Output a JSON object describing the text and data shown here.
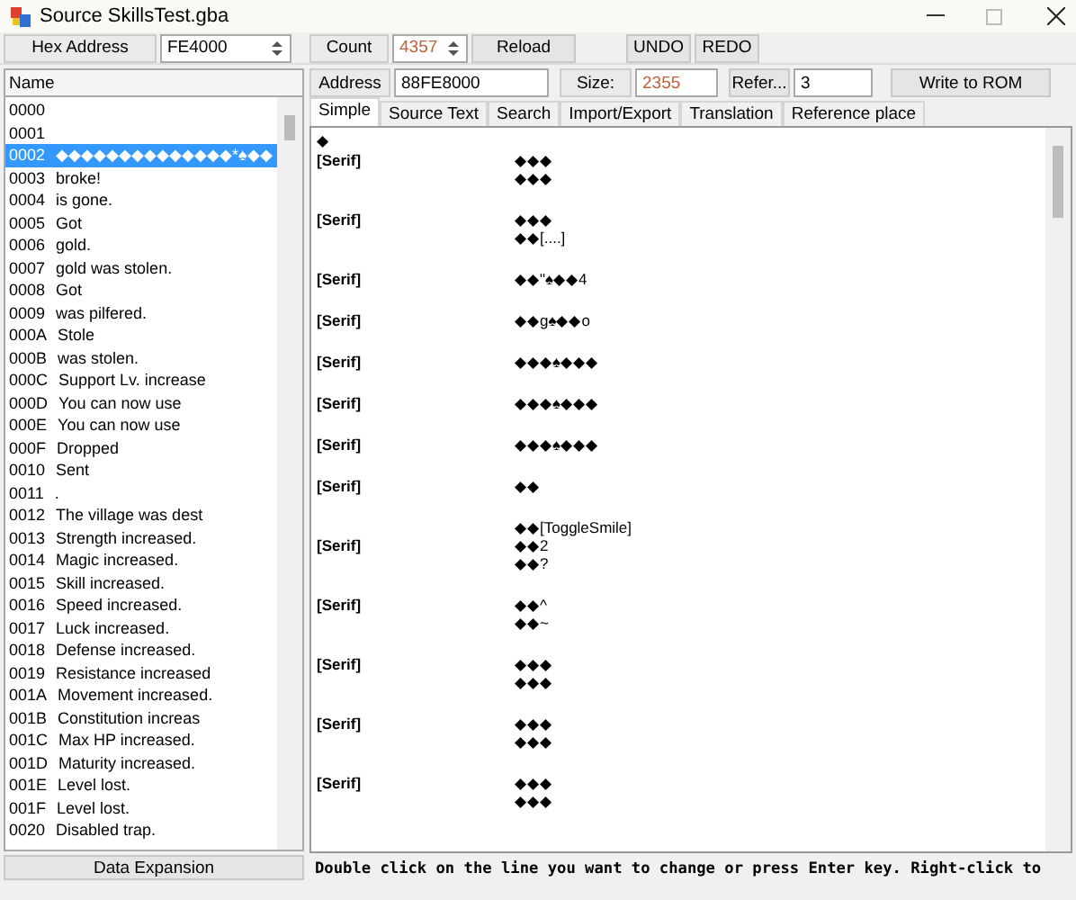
{
  "window": {
    "title": "Source SkillsTest.gba"
  },
  "toolbar": {
    "hex_address_label": "Hex Address",
    "hex_address": "FE4000",
    "count_label": "Count",
    "count": "4357",
    "buttons": [
      "Reload",
      "UNDO",
      "REDO"
    ]
  },
  "list": {
    "header": "Name",
    "items": [
      {
        "id": "0000",
        "selected": false
      },
      {
        "id": "0001",
        "selected": false
      },
      {
        "id": "0002",
        "text": "◆◆◆◆◆◆◆◆◆◆◆◆◆◆*♠◆◆",
        "selected": true
      },
      {
        "id": "0003",
        "text": "broke!",
        "selected": false
      },
      {
        "id": "0004",
        "text": "is gone.",
        "selected": false
      },
      {
        "id": "0005",
        "text": "Got",
        "selected": false
      },
      {
        "id": "0006",
        "text": "gold.",
        "selected": false
      },
      {
        "id": "0007",
        "text": "gold was stolen.",
        "selected": false
      },
      {
        "id": "0008",
        "text": "Got",
        "selected": false
      },
      {
        "id": "0009",
        "text": "was pilfered.",
        "selected": false
      },
      {
        "id": "000A",
        "text": "Stole",
        "selected": false
      },
      {
        "id": "000B",
        "text": "was stolen.",
        "selected": false
      },
      {
        "id": "000C",
        "text": "Support Lv. increase",
        "selected": false
      },
      {
        "id": "000D",
        "text": "You can now use",
        "selected": false
      },
      {
        "id": "000E",
        "text": "You can now use",
        "selected": false
      },
      {
        "id": "000F",
        "text": "Dropped",
        "selected": false
      },
      {
        "id": "0010",
        "text": "Sent",
        "selected": false
      },
      {
        "id": "0011",
        "text": ".",
        "selected": false
      },
      {
        "id": "0012",
        "text": "The village was dest",
        "selected": false
      },
      {
        "id": "0013",
        "text": "Strength increased.",
        "selected": false
      },
      {
        "id": "0014",
        "text": "Magic increased.",
        "selected": false
      },
      {
        "id": "0015",
        "text": "Skill increased.",
        "selected": false
      },
      {
        "id": "0016",
        "text": "Speed increased.",
        "selected": false
      },
      {
        "id": "0017",
        "text": "Luck increased.",
        "selected": false
      },
      {
        "id": "0018",
        "text": "Defense increased.",
        "selected": false
      },
      {
        "id": "0019",
        "text": "Resistance increased",
        "selected": false
      },
      {
        "id": "001A",
        "text": "Movement increased.",
        "selected": false
      },
      {
        "id": "001B",
        "text": "Constitution increas",
        "selected": false
      },
      {
        "id": "001C",
        "text": "Max HP increased.",
        "selected": false
      },
      {
        "id": "001D",
        "text": "Maturity increased.",
        "selected": false
      },
      {
        "id": "001E",
        "text": "Level lost.",
        "selected": false
      },
      {
        "id": "001F",
        "text": "Level lost.",
        "selected": false
      },
      {
        "id": "0020",
        "text": "Disabled trap.",
        "selected": false
      }
    ],
    "footer_button": "Data Expansion"
  },
  "detail": {
    "address_label": "Address",
    "address": "88FE8000",
    "size_label": "Size:",
    "size": "2355",
    "refer_button": "Refer...",
    "refer_count": "3",
    "write_button": "Write to ROM"
  },
  "tabs": [
    {
      "label": "Simple",
      "selected": true
    },
    {
      "label": "Source Text",
      "selected": false
    },
    {
      "label": "Search",
      "selected": false
    },
    {
      "label": "Import/Export",
      "selected": false
    },
    {
      "label": "Translation",
      "selected": false
    },
    {
      "label": "Reference place",
      "selected": false
    }
  ],
  "text_view": {
    "first_line": "◆",
    "entries": [
      {
        "label": "[Serif]",
        "lines": [
          "◆◆◆",
          "◆◆◆"
        ]
      },
      {
        "label": "[Serif]",
        "lines": [
          "◆◆◆",
          "◆◆[....]"
        ]
      },
      {
        "label": "[Serif]",
        "lines": [
          "◆◆\"♠◆◆4"
        ]
      },
      {
        "label": "[Serif]",
        "lines": [
          "◆◆g♠◆◆o"
        ]
      },
      {
        "label": "[Serif]",
        "lines": [
          "◆◆◆♠◆◆◆"
        ]
      },
      {
        "label": "[Serif]",
        "lines": [
          "◆◆◆♠◆◆◆"
        ]
      },
      {
        "label": "[Serif]",
        "lines": [
          "◆◆◆♠◆◆◆"
        ]
      },
      {
        "label": "[Serif]",
        "lines": [
          "◆◆"
        ]
      },
      {
        "label": "[Serif]",
        "lines": [
          "◆◆[ToggleSmile]",
          "◆◆2",
          "◆◆?"
        ]
      },
      {
        "label": "[Serif]",
        "lines": [
          "◆◆^",
          "◆◆~"
        ]
      },
      {
        "label": "[Serif]",
        "lines": [
          "◆◆◆",
          "◆◆◆"
        ]
      },
      {
        "label": "[Serif]",
        "lines": [
          "◆◆◆",
          "◆◆◆"
        ]
      },
      {
        "label": "[Serif]",
        "lines": [
          "◆◆◆",
          "◆◆◆"
        ]
      }
    ]
  },
  "status": "Double click on the line you want to change or press Enter key. Right-click to"
}
